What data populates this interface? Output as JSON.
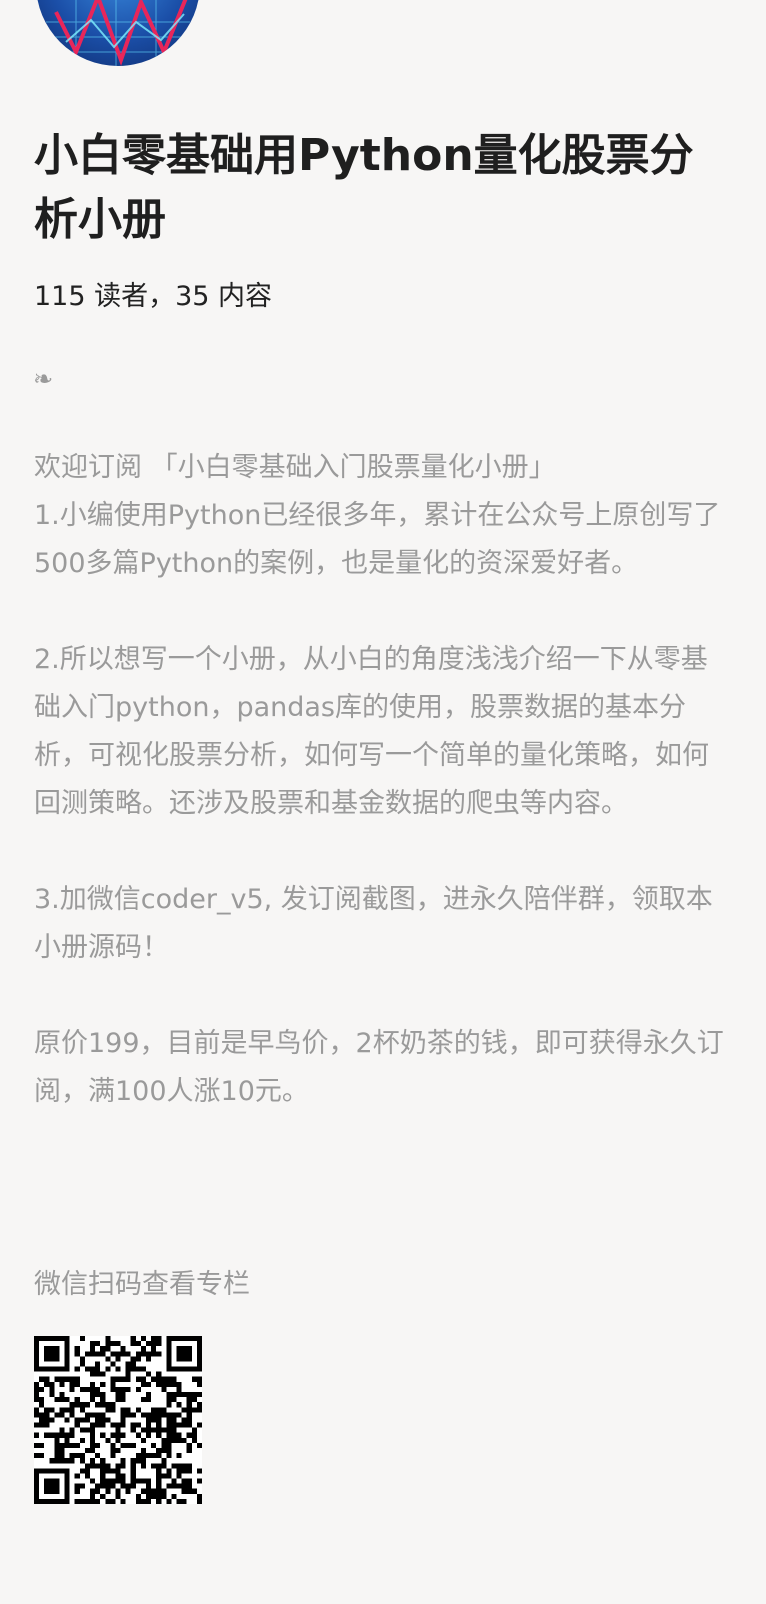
{
  "header": {
    "avatar_icon": "stock-chart-avatar-icon",
    "title": "小白零基础用Python量化股票分析小册",
    "stats": "115 读者，35 内容"
  },
  "body": {
    "fleuron": "❧",
    "paragraphs": [
      "欢迎订阅 「小白零基础入门股票量化小册」\n1.小编使用Python已经很多年，累计在公众号上原创写了500多篇Python的案例，也是量化的资深爱好者。",
      "2.所以想写一个小册，从小白的角度浅浅介绍一下从零基础入门python，pandas库的使用，股票数据的基本分析，可视化股票分析，如何写一个简单的量化策略，如何回测策略。还涉及股票和基金数据的爬虫等内容。",
      "3.加微信coder_v5, 发订阅截图，进永久陪伴群，领取本小册源码！",
      "原价199，目前是早鸟价，2杯奶茶的钱，即可获得永久订阅，满100人涨10元。"
    ],
    "scan_label": "微信扫码查看专栏",
    "qr_icon": "qr-code-icon"
  },
  "colors": {
    "background": "#f7f6f5",
    "title": "#1f1f1f",
    "muted": "#9a9a9a"
  }
}
